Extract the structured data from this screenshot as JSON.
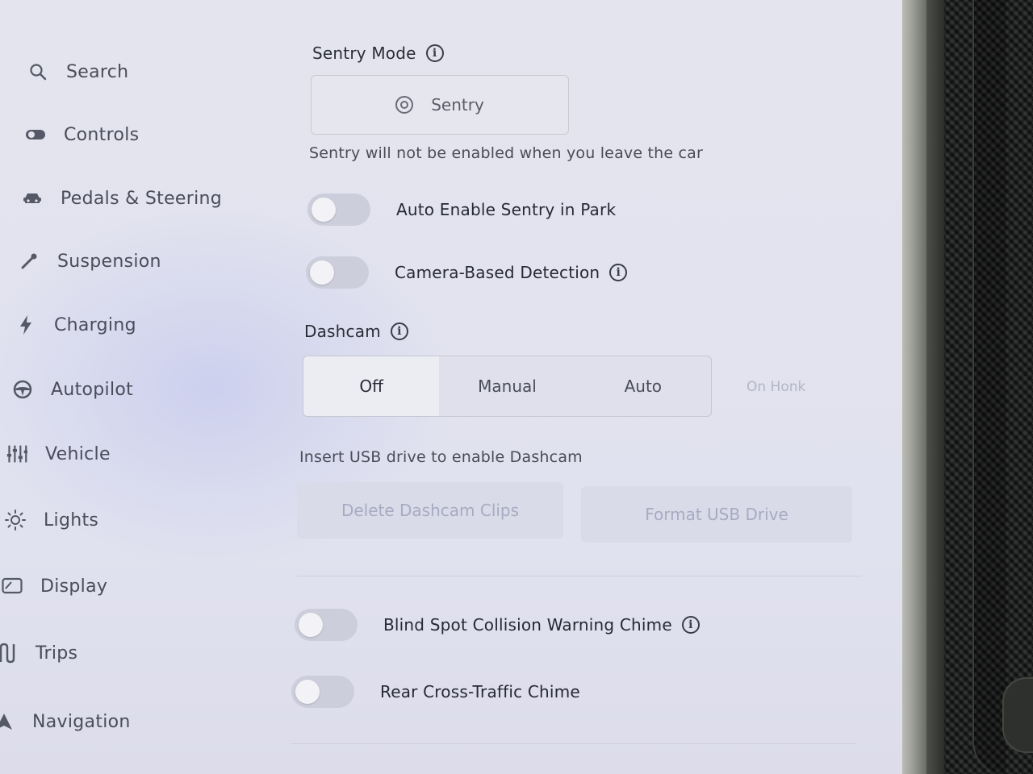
{
  "sidebar": {
    "items": [
      {
        "label": "Search",
        "icon": "search-icon"
      },
      {
        "label": "Controls",
        "icon": "toggle-icon"
      },
      {
        "label": "Pedals & Steering",
        "icon": "car-icon"
      },
      {
        "label": "Suspension",
        "icon": "wrench-icon"
      },
      {
        "label": "Charging",
        "icon": "lightning-icon"
      },
      {
        "label": "Autopilot",
        "icon": "steering-wheel-icon"
      },
      {
        "label": "Vehicle",
        "icon": "sliders-icon"
      },
      {
        "label": "Lights",
        "icon": "sun-icon"
      },
      {
        "label": "Display",
        "icon": "display-icon"
      },
      {
        "label": "Trips",
        "icon": "trips-icon"
      },
      {
        "label": "Navigation",
        "icon": "navigation-icon"
      }
    ]
  },
  "sentry": {
    "title": "Sentry Mode",
    "button_label": "Sentry",
    "note": "Sentry will not be enabled when you leave the car",
    "auto_enable_label": "Auto Enable Sentry in Park",
    "camera_detection_label": "Camera-Based Detection"
  },
  "dashcam": {
    "title": "Dashcam",
    "options": [
      "Off",
      "Manual",
      "Auto"
    ],
    "selected": "Off",
    "extra_option": "On Honk",
    "note": "Insert USB drive to enable Dashcam",
    "delete_label": "Delete Dashcam Clips",
    "format_label": "Format USB Drive"
  },
  "chimes": {
    "blind_spot_label": "Blind Spot Collision Warning Chime",
    "rear_cross_label": "Rear Cross-Traffic Chime"
  },
  "colors": {
    "screen_bg": "#e2e3ef",
    "toggle_off": "#cdcedb",
    "text_dark": "#262833",
    "text_disabled": "#a8aac2"
  }
}
